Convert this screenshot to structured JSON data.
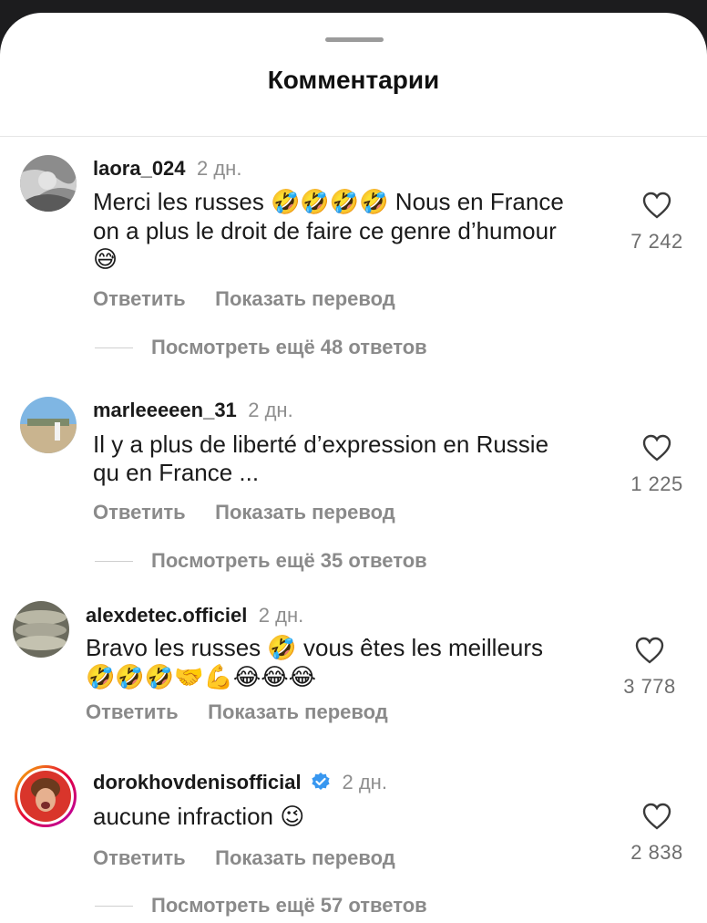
{
  "header": {
    "title": "Комментарии"
  },
  "comments": [
    {
      "username": "laora_024",
      "time": "2 дн.",
      "text_line1": "Merci les russes",
      "emoji_line1": "🤣🤣🤣🤣",
      "text_line1b": "Nous en France",
      "text_line2": "on a plus le droit de faire ce genre d’humour",
      "emoji_line3": "😅",
      "likes": "7 242",
      "reply_label": "Ответить",
      "translate_label": "Показать перевод",
      "replies_label": "Посмотреть ещё 48 ответов"
    },
    {
      "username": "marleeeeen_31",
      "time": "2 дн.",
      "text_line1": "Il y a plus de liberté d’expression en Russie",
      "text_line2": "qu en France ...",
      "likes": "1 225",
      "reply_label": "Ответить",
      "translate_label": "Показать перевод",
      "replies_label": "Посмотреть ещё 35 ответов"
    },
    {
      "username": "alexdetec.officiel",
      "time": "2 дн.",
      "text_line1a": "Bravo les russes",
      "emoji_line1": "🤣",
      "text_line1b": "vous êtes les meilleurs",
      "emoji_line2": "🤣🤣🤣🤝💪😂😂😂",
      "likes": "3 778",
      "reply_label": "Ответить",
      "translate_label": "Показать перевод"
    },
    {
      "username": "dorokhovdenisofficial",
      "time": "2 дн.",
      "text_line1": "aucune infraction",
      "emoji_line1": "😉",
      "likes": "2 838",
      "reply_label": "Ответить",
      "translate_label": "Показать перевод",
      "replies_label": "Посмотреть ещё 57 ответов"
    }
  ]
}
